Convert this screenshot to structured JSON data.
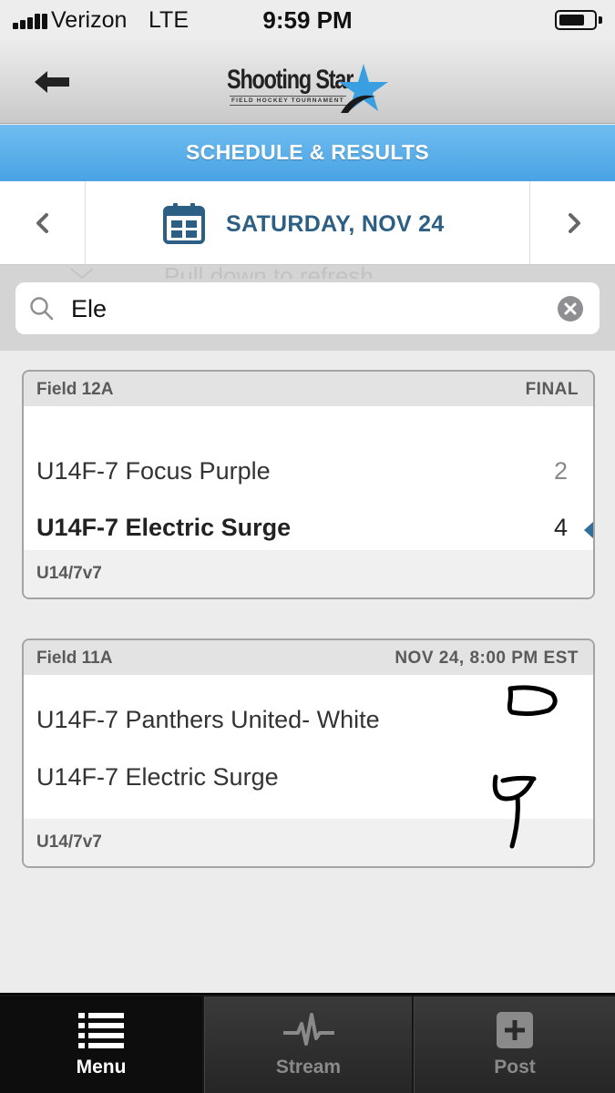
{
  "status_bar": {
    "carrier": "Verizon",
    "network": "LTE",
    "time": "9:59 PM",
    "battery_level": 0.75
  },
  "header": {
    "back_icon": "arrow-left-icon",
    "logo_text": "Shooting Star",
    "logo_subtitle": "FIELD HOCKEY TOURNAMENT"
  },
  "section": {
    "title": "SCHEDULE & RESULTS",
    "color": "#4ea7e6"
  },
  "date_nav": {
    "prev_icon": "chevron-left-icon",
    "next_icon": "chevron-right-icon",
    "calendar_icon": "calendar-icon",
    "date_label": "SATURDAY, NOV 24",
    "accent_color": "#2d5f84"
  },
  "pull_hint": "Pull down to refresh",
  "search": {
    "value": "Ele",
    "search_icon": "search-icon",
    "clear_icon": "clear-icon"
  },
  "games": [
    {
      "field": "Field 12A",
      "status": "FINAL",
      "teams": [
        {
          "name": "U14F-7 Focus Purple",
          "score": "2",
          "winner": false
        },
        {
          "name": "U14F-7 Electric Surge",
          "score": "4",
          "winner": true
        }
      ],
      "division": "U14/7v7"
    },
    {
      "field": "Field 11A",
      "status": "NOV 24, 8:00 PM EST",
      "teams": [
        {
          "name": "U14F-7 Panthers United- White",
          "score": "",
          "winner": false
        },
        {
          "name": "U14F-7 Electric Surge",
          "score": "",
          "winner": false
        }
      ],
      "division": "U14/7v7"
    }
  ],
  "tab_bar": {
    "tabs": [
      {
        "label": "Menu",
        "icon": "menu-list-icon",
        "active": true
      },
      {
        "label": "Stream",
        "icon": "pulse-icon",
        "active": false
      },
      {
        "label": "Post",
        "icon": "plus-icon",
        "active": false
      }
    ]
  }
}
